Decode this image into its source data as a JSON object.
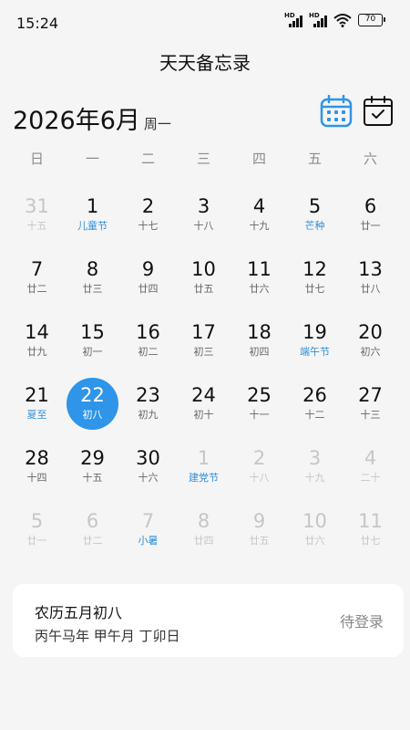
{
  "status_bar": {
    "time": "15:24",
    "hd1": "HD",
    "hd2": "HD",
    "battery": "70"
  },
  "app_title": "天天备忘录",
  "header": {
    "year_month": "2026年6月",
    "weekday": "周一"
  },
  "weekdays": [
    "日",
    "一",
    "二",
    "三",
    "四",
    "五",
    "六"
  ],
  "colors": {
    "accent": "#2e95e8",
    "festival": "#2f8fd8",
    "dim": "#c6c6c6"
  },
  "days": [
    {
      "num": "31",
      "lunar": "十五",
      "dim": true
    },
    {
      "num": "1",
      "lunar": "儿童节",
      "festival": true
    },
    {
      "num": "2",
      "lunar": "十七"
    },
    {
      "num": "3",
      "lunar": "十八"
    },
    {
      "num": "4",
      "lunar": "十九"
    },
    {
      "num": "5",
      "lunar": "芒种",
      "festival": true
    },
    {
      "num": "6",
      "lunar": "廿一"
    },
    {
      "num": "7",
      "lunar": "廿二"
    },
    {
      "num": "8",
      "lunar": "廿三"
    },
    {
      "num": "9",
      "lunar": "廿四"
    },
    {
      "num": "10",
      "lunar": "廿五"
    },
    {
      "num": "11",
      "lunar": "廿六"
    },
    {
      "num": "12",
      "lunar": "廿七"
    },
    {
      "num": "13",
      "lunar": "廿八"
    },
    {
      "num": "14",
      "lunar": "廿九"
    },
    {
      "num": "15",
      "lunar": "初一"
    },
    {
      "num": "16",
      "lunar": "初二"
    },
    {
      "num": "17",
      "lunar": "初三"
    },
    {
      "num": "18",
      "lunar": "初四"
    },
    {
      "num": "19",
      "lunar": "端午节",
      "festival": true
    },
    {
      "num": "20",
      "lunar": "初六"
    },
    {
      "num": "21",
      "lunar": "夏至",
      "festival": true
    },
    {
      "num": "22",
      "lunar": "初八",
      "selected": true
    },
    {
      "num": "23",
      "lunar": "初九"
    },
    {
      "num": "24",
      "lunar": "初十"
    },
    {
      "num": "25",
      "lunar": "十一"
    },
    {
      "num": "26",
      "lunar": "十二"
    },
    {
      "num": "27",
      "lunar": "十三"
    },
    {
      "num": "28",
      "lunar": "十四"
    },
    {
      "num": "29",
      "lunar": "十五"
    },
    {
      "num": "30",
      "lunar": "十六"
    },
    {
      "num": "1",
      "lunar": "建党节",
      "dim": true,
      "festival": true
    },
    {
      "num": "2",
      "lunar": "十八",
      "dim": true
    },
    {
      "num": "3",
      "lunar": "十九",
      "dim": true
    },
    {
      "num": "4",
      "lunar": "二十",
      "dim": true
    },
    {
      "num": "5",
      "lunar": "廿一",
      "dim": true
    },
    {
      "num": "6",
      "lunar": "廿二",
      "dim": true
    },
    {
      "num": "7",
      "lunar": "小暑",
      "dim": true,
      "festival": true
    },
    {
      "num": "8",
      "lunar": "廿四",
      "dim": true
    },
    {
      "num": "9",
      "lunar": "廿五",
      "dim": true
    },
    {
      "num": "10",
      "lunar": "廿六",
      "dim": true
    },
    {
      "num": "11",
      "lunar": "廿七",
      "dim": true
    }
  ],
  "info_card": {
    "lunar_date": "农历五月初八",
    "ganzhi": "丙午马年 甲午月 丁卯日",
    "login": "待登录"
  }
}
